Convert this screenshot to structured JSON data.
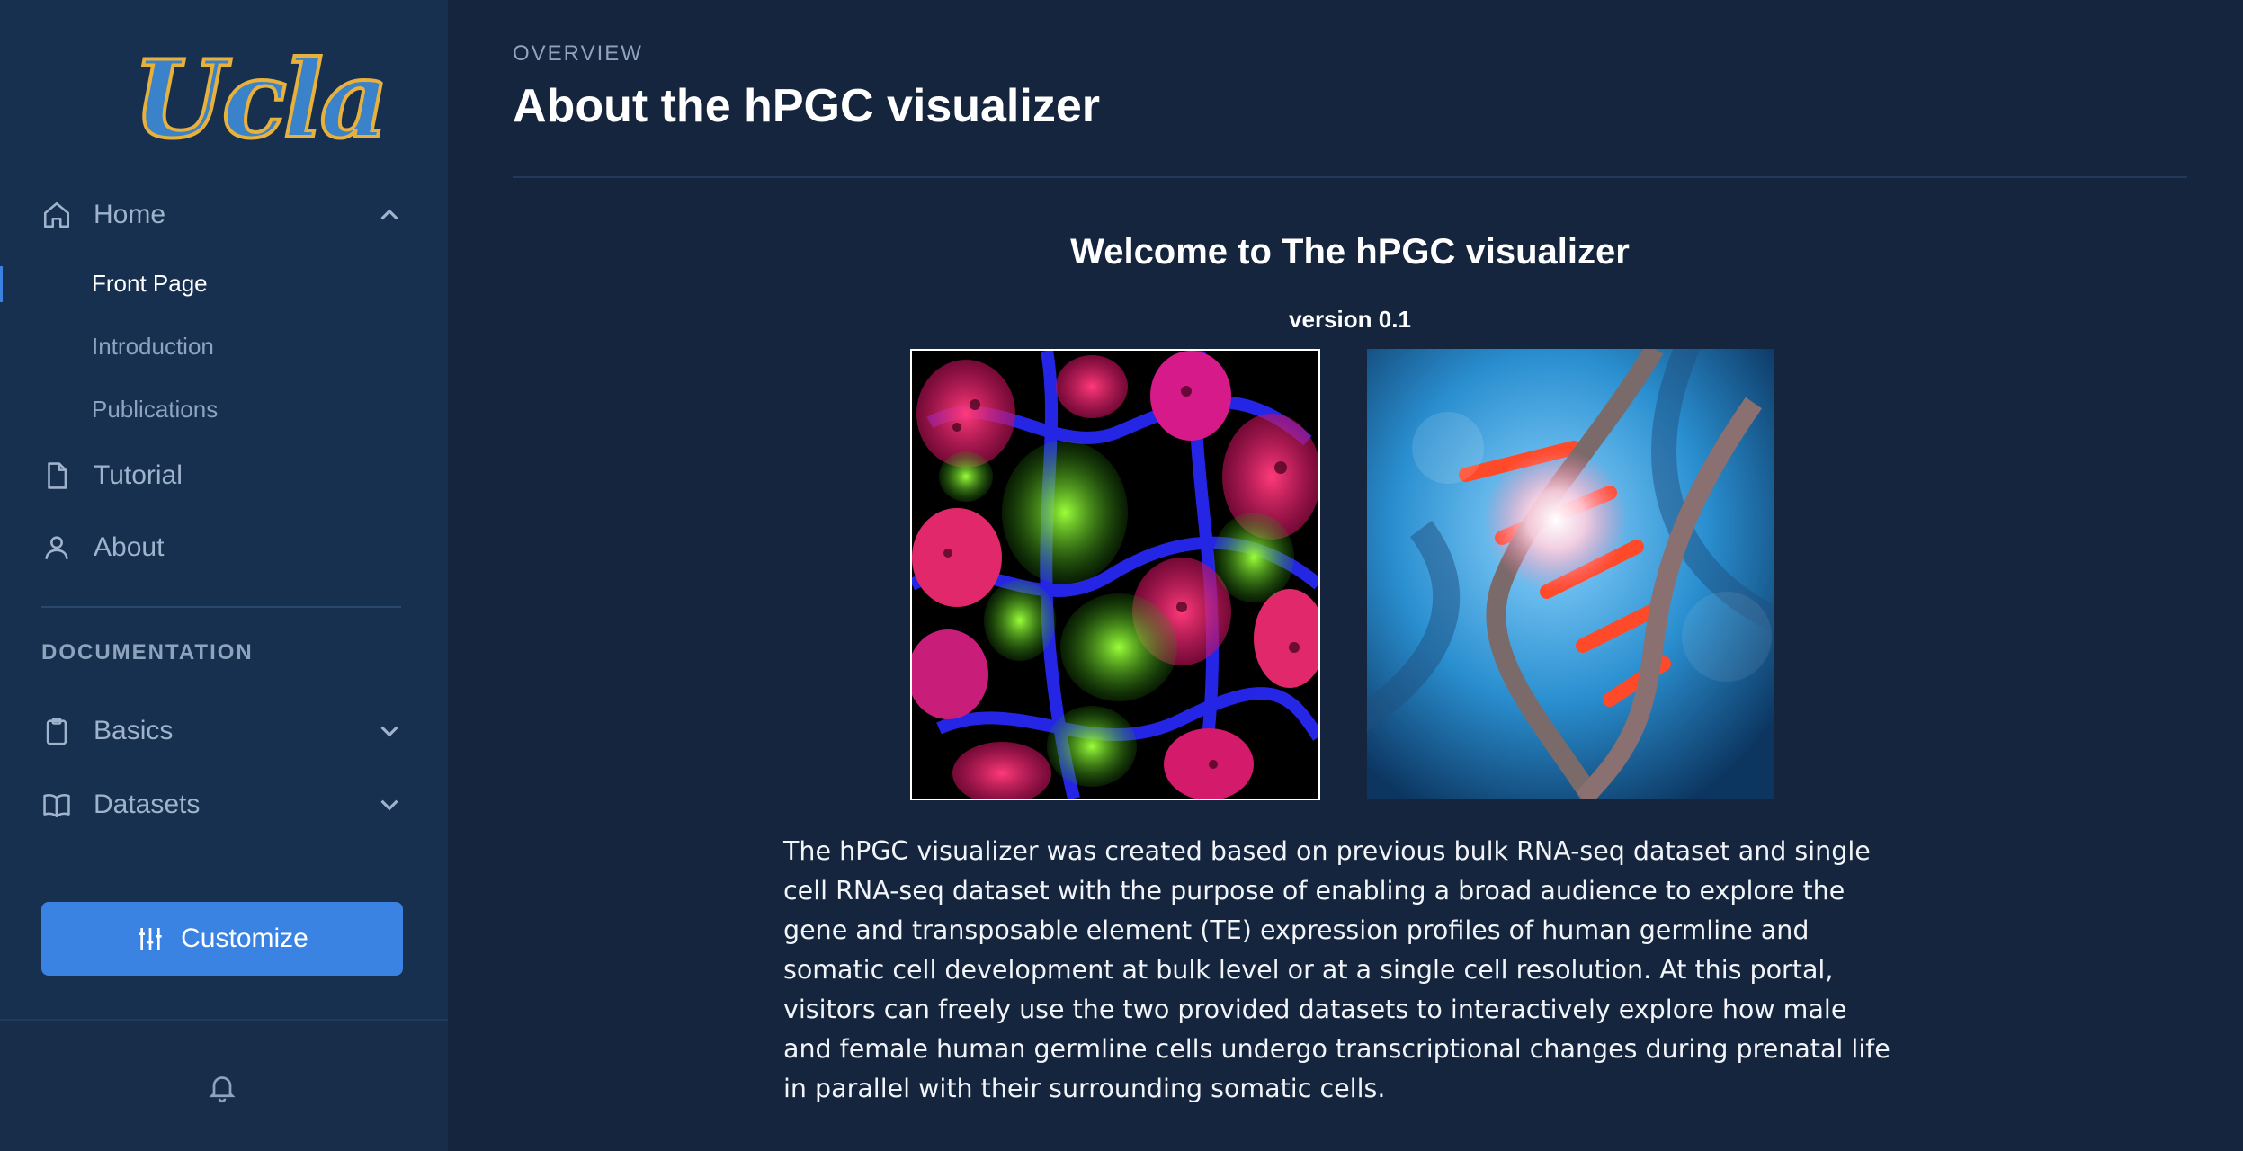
{
  "sidebar": {
    "logo": "Ucla",
    "nav": {
      "home": "Home",
      "tutorial": "Tutorial",
      "about": "About",
      "basics": "Basics",
      "datasets": "Datasets"
    },
    "home_children": [
      "Front Page",
      "Introduction",
      "Publications"
    ],
    "active_item": "Front Page",
    "section_label": "DOCUMENTATION",
    "customize_label": "Customize"
  },
  "main": {
    "eyebrow": "OVERVIEW",
    "title": "About the hPGC visualizer",
    "welcome": "Welcome to The hPGC visualizer",
    "version": "version 0.1",
    "description": "The hPGC visualizer was created based on previous bulk RNA-seq dataset and single cell RNA-seq dataset with the purpose of enabling a broad audience to explore the gene and transposable element (TE) expression profiles of human germline and somatic cell development at bulk level or at a single cell resolution. At this portal, visitors can freely use the two provided datasets to interactively explore how male and female human germline cells undergo transcriptional changes during prenatal life in parallel with their surrounding somatic cells."
  },
  "colors": {
    "background": "#14253d",
    "sidebar": "#17304f",
    "accent": "#3a83e3",
    "logo_blue": "#3a82c9",
    "logo_gold": "#e8b13b"
  },
  "icons": {
    "home": "home-icon",
    "tutorial": "document-icon",
    "about": "user-icon",
    "basics": "clipboard-icon",
    "datasets": "book-open-icon",
    "customize": "sliders-icon",
    "notifications": "bell-icon"
  }
}
